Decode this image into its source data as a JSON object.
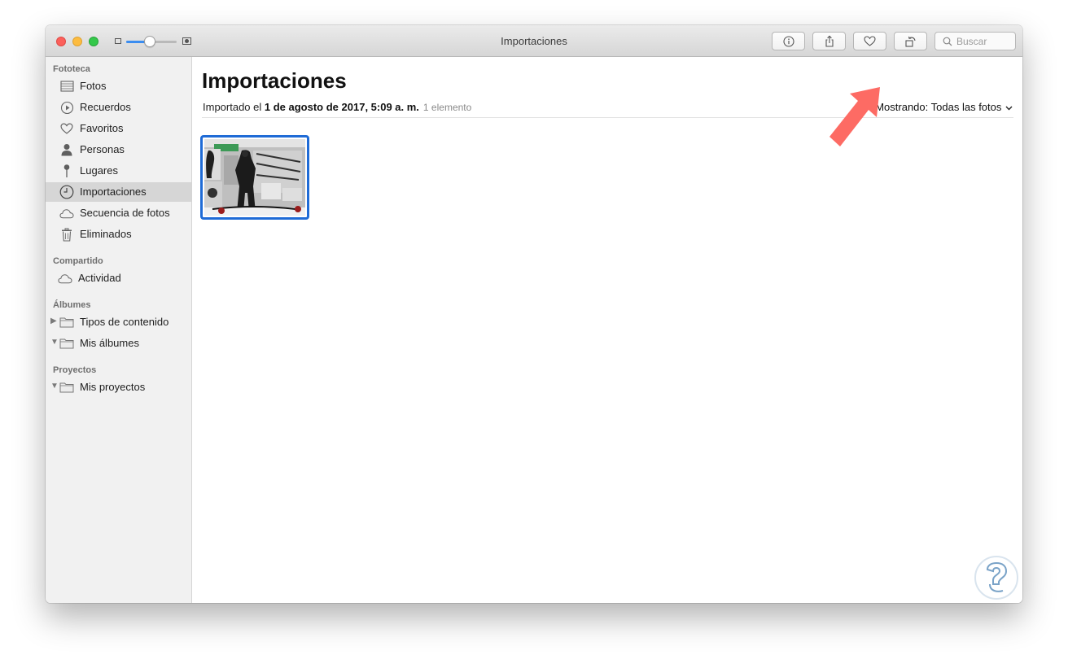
{
  "window": {
    "title": "Importaciones"
  },
  "toolbar": {
    "buttons": [
      {
        "name": "info",
        "icon": "info-icon"
      },
      {
        "name": "share",
        "icon": "share-icon"
      },
      {
        "name": "favorite",
        "icon": "heart-icon"
      },
      {
        "name": "rotate",
        "icon": "rotate-icon"
      }
    ],
    "search_placeholder": "Buscar",
    "zoom_level": 0.47
  },
  "sidebar": {
    "sections": [
      {
        "title": "Fototeca",
        "items": [
          {
            "label": "Fotos",
            "icon": "photos-icon"
          },
          {
            "label": "Recuerdos",
            "icon": "memories-icon"
          },
          {
            "label": "Favoritos",
            "icon": "heart-icon"
          },
          {
            "label": "Personas",
            "icon": "person-icon"
          },
          {
            "label": "Lugares",
            "icon": "pin-icon"
          },
          {
            "label": "Importaciones",
            "icon": "clock-icon",
            "selected": true
          },
          {
            "label": "Secuencia de fotos",
            "icon": "cloud-icon"
          },
          {
            "label": "Eliminados",
            "icon": "trash-icon"
          }
        ]
      },
      {
        "title": "Compartido",
        "items": [
          {
            "label": "Actividad",
            "icon": "cloud-icon"
          }
        ]
      },
      {
        "title": "Álbumes",
        "items": [
          {
            "label": "Tipos de contenido",
            "icon": "folder-icon",
            "disclosure": "collapsed"
          },
          {
            "label": "Mis álbumes",
            "icon": "folder-icon",
            "disclosure": "expanded"
          }
        ]
      },
      {
        "title": "Proyectos",
        "items": [
          {
            "label": "Mis proyectos",
            "icon": "folder-icon",
            "disclosure": "expanded"
          }
        ]
      }
    ]
  },
  "main": {
    "title": "Importaciones",
    "meta_prefix": "Importado el",
    "meta_date": "1 de agosto de 2017, 5:09 a. m.",
    "meta_count": "1 elemento",
    "showing_label": "Mostrando:",
    "showing_value": "Todas las fotos",
    "photos": [
      {
        "name": "imported-photo",
        "selected": true
      }
    ]
  },
  "colors": {
    "selection": "#1f6bd6",
    "annotation_arrow": "#fd6b64",
    "accent": "#3b8df0"
  }
}
